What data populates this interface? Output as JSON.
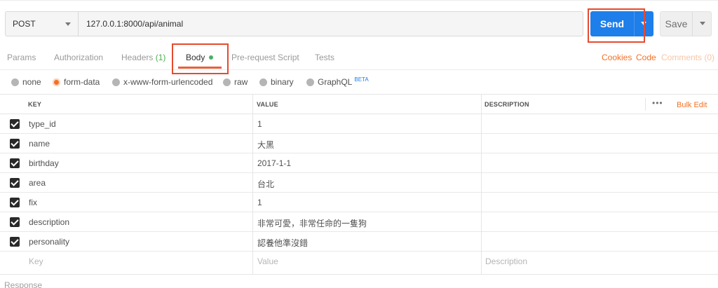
{
  "request": {
    "method": "POST",
    "url": "127.0.0.1:8000/api/animal",
    "send_label": "Send",
    "save_label": "Save"
  },
  "tabs": {
    "params": "Params",
    "authorization": "Authorization",
    "headers": "Headers",
    "headers_count": "(1)",
    "body": "Body",
    "prerequest": "Pre-request Script",
    "tests": "Tests"
  },
  "links": {
    "cookies": "Cookies",
    "code": "Code",
    "comments": "Comments (0)"
  },
  "body_types": {
    "none": "none",
    "form_data": "form-data",
    "urlencoded": "x-www-form-urlencoded",
    "raw": "raw",
    "binary": "binary",
    "graphql": "GraphQL",
    "beta": "BETA",
    "selected": "form-data"
  },
  "table": {
    "headers": {
      "key": "KEY",
      "value": "VALUE",
      "description": "DESCRIPTION",
      "more": "•••",
      "bulk_edit": "Bulk Edit"
    },
    "rows": [
      {
        "key": "type_id",
        "value": "1",
        "description": ""
      },
      {
        "key": "name",
        "value": "大黑",
        "description": ""
      },
      {
        "key": "birthday",
        "value": "2017-1-1",
        "description": ""
      },
      {
        "key": "area",
        "value": "台北",
        "description": ""
      },
      {
        "key": "fix",
        "value": "1",
        "description": ""
      },
      {
        "key": "description",
        "value": "非常可愛，非常任命的一隻狗",
        "description": ""
      },
      {
        "key": "personality",
        "value": "認養他準沒錯",
        "description": ""
      }
    ],
    "placeholders": {
      "key": "Key",
      "value": "Value",
      "description": "Description"
    }
  },
  "response": {
    "label": "Response"
  },
  "colors": {
    "send": "#1e7eea",
    "accent": "#f47023",
    "highlight": "#e44b2f",
    "body_dot": "#48b167"
  }
}
